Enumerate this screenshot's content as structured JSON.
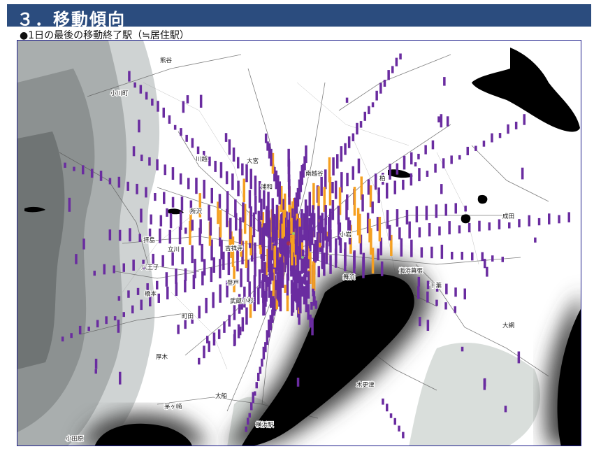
{
  "slide": {
    "title": "３．移動傾向",
    "subtitle": "●1日の最後の移動終了駅（≒居住駅）"
  },
  "map": {
    "colors": {
      "frame": "#1e1f8c",
      "title_bar": "#2b4c7e",
      "bar_primary": "#6a2ca0",
      "bar_highlight": "#f5a020",
      "sea": "#000000",
      "terrain": "#8a8a8a"
    },
    "place_labels": [
      "熊谷",
      "小川町",
      "川越",
      "大宮",
      "南越谷",
      "浦和",
      "所沢",
      "柏",
      "成田",
      "拝島",
      "立川",
      "吉祥寺",
      "小岩",
      "八王子",
      "海浜幕張",
      "千葉",
      "橋本",
      "登戸",
      "舞浜",
      "町田",
      "武蔵小杉",
      "大網",
      "厚木",
      "木更津",
      "茅ヶ崎",
      "大船",
      "横浜駅",
      "小田原"
    ]
  }
}
